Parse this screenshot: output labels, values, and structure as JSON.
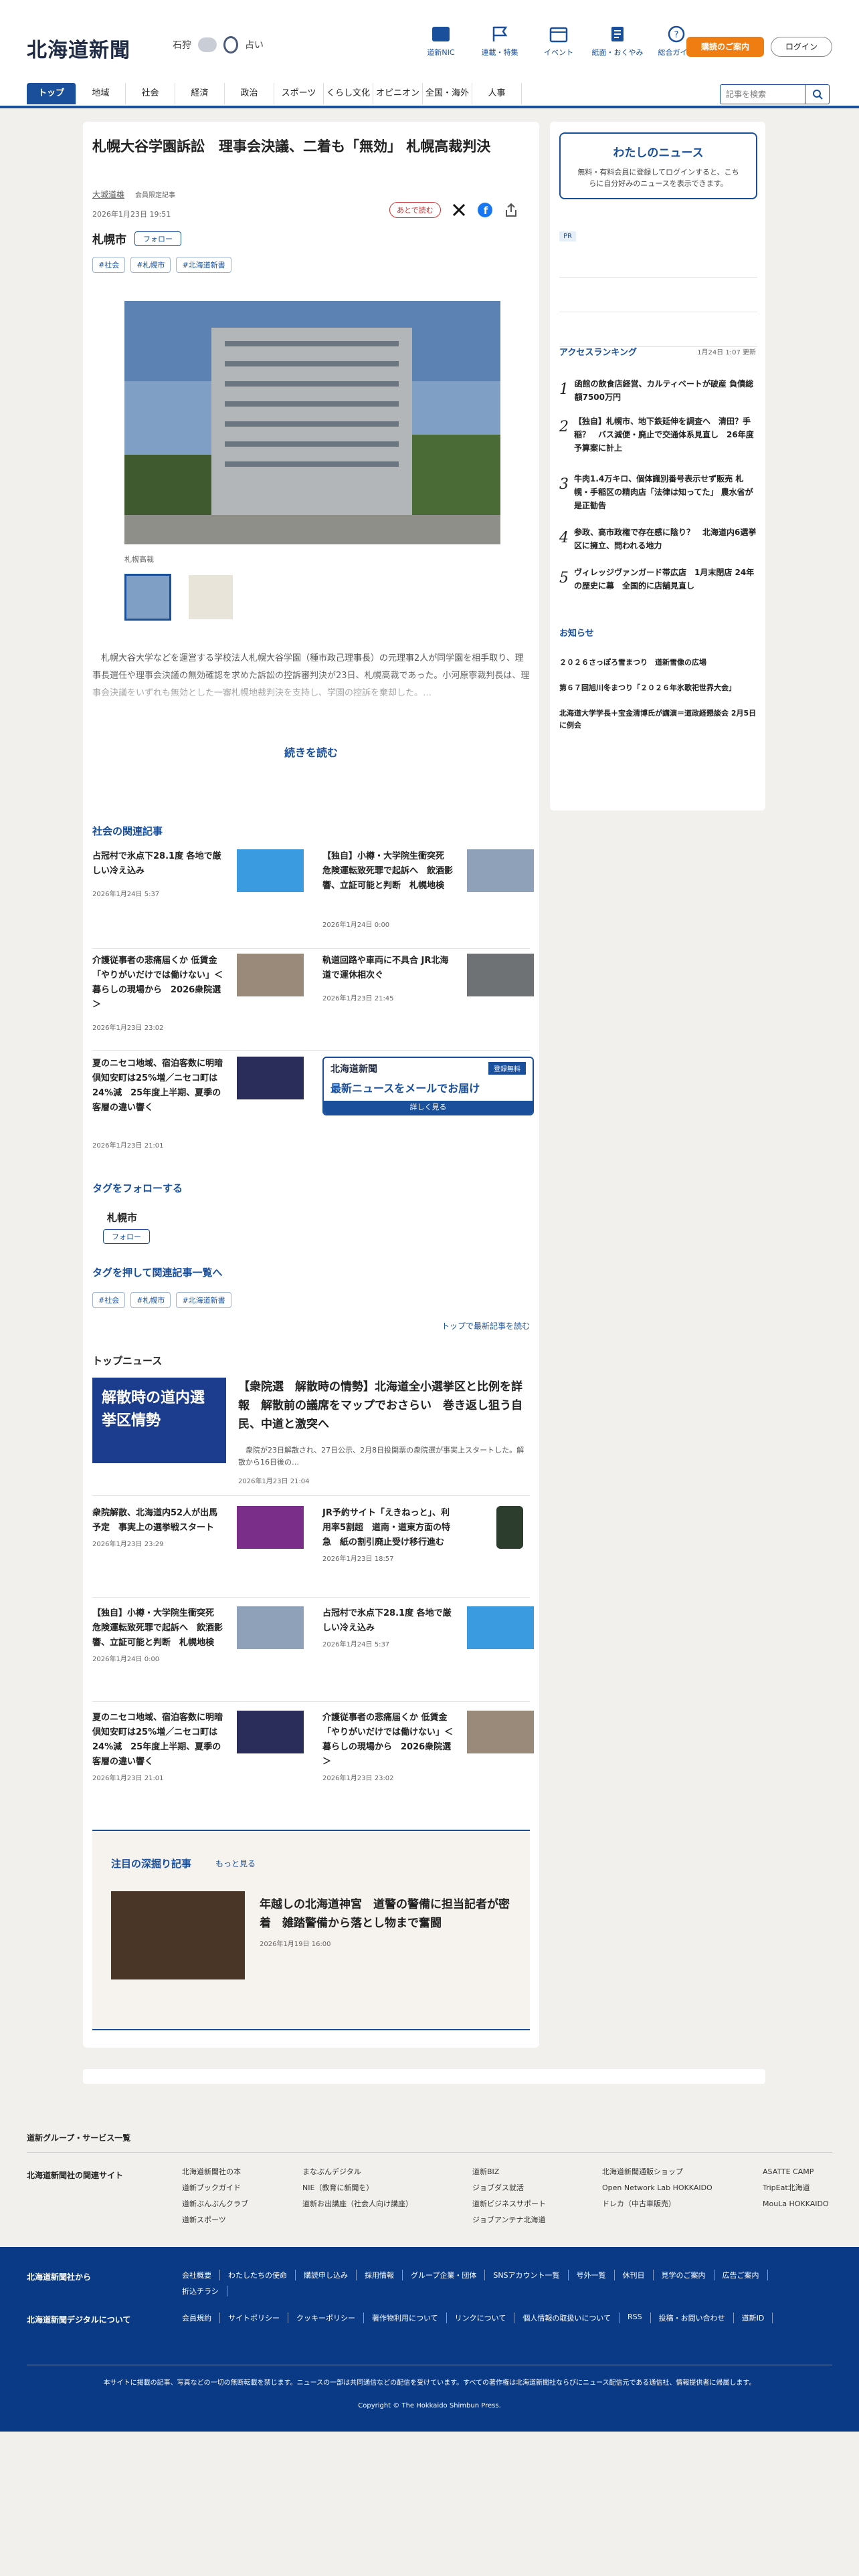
{
  "header": {
    "logo": "北海道新聞",
    "weather_city": "石狩",
    "weather_note": "占い",
    "icons": [
      {
        "label": "道新NIC",
        "icon": "note-icon"
      },
      {
        "label": "連載・特集",
        "icon": "flag-icon"
      },
      {
        "label": "イベント",
        "icon": "calendar-icon"
      },
      {
        "label": "紙面・おくやみ",
        "icon": "newspaper-icon"
      },
      {
        "label": "総合ガイド",
        "icon": "help-icon"
      }
    ],
    "member_button": "購読のご案内",
    "login_button": "ログイン"
  },
  "nav": {
    "items": [
      "トップ",
      "地域",
      "社会",
      "経済",
      "政治",
      "スポーツ",
      "くらし文化",
      "オピニオン",
      "全国・海外",
      "人事"
    ],
    "search_placeholder": "記事を検索"
  },
  "article": {
    "title": "札幌大谷学園訴訟　理事会決議、二着も「無効」 札幌高裁判決",
    "author": "大城道雄",
    "member_badge": "会員限定記事",
    "date": "2026年1月23日 19:51",
    "later_label": "あとで読む",
    "location": "札幌市",
    "follow_label": "フォロー",
    "tags": [
      "#社会",
      "#札幌市",
      "#北海道新書"
    ],
    "caption": "札幌高裁",
    "lead": "札幌大谷大学などを運営する学校法人札幌大谷学園（種市政己理事長）の元理事2人が同学園を相手取り、理事長選任や理事会決議の無効確認を求めた訴訟の控訴審判決が23日、札幌高裁であった。小河原寧裁判長は、理事会決議をいずれも無効とした一審札幌地裁判決を支持し、学園の控訴を棄却した。…",
    "read_more": "続きを読む"
  },
  "related": {
    "heading": "社会の関連記事",
    "items": [
      {
        "title": "占冠村で氷点下28.1度 各地で厳しい冷え込み",
        "date": "2026年1月24日 5:37"
      },
      {
        "title": "【独自】小樽・大学院生衝突死　危険運転致死罪で起訴へ　飲酒影響、立証可能と判断　札幌地検",
        "date": "2026年1月24日 0:00"
      },
      {
        "title": "介護従事者の悲痛届くか 低賃金「やりがいだけでは働けない」＜暮らしの現場から　2026衆院選＞",
        "date": "2026年1月23日 23:02"
      },
      {
        "title": "軌道回路や車両に不具合 JR北海道で運休相次ぐ",
        "date": "2026年1月23日 21:45"
      },
      {
        "title": "夏のニセコ地域、宿泊客数に明暗　倶知安町は25%増／ニセコ町は24%減　25年度上半期、夏季の客層の違い響く",
        "date": "2026年1月23日 21:01"
      }
    ],
    "ad_logo": "北海道新聞",
    "ad_badge": "登録無料",
    "ad_text": "最新ニュースをメールでお届け",
    "ad_button": "詳しく見る"
  },
  "follow_tags": {
    "heading": "タグをフォローする",
    "location": "札幌市",
    "follow_label": "フォロー",
    "heading2": "タグを押して関連記事一覧へ",
    "tags": [
      "#社会",
      "#札幌市",
      "#北海道新書"
    ],
    "to_top": "トップで最新記事を読む"
  },
  "top_news": {
    "heading": "トップニュース",
    "lead_title": "【衆院選　解散時の情勢】北海道全小選挙区と比例を詳報　解散前の議席をマップでおさらい　巻き返し狙う自民、中道と激突へ",
    "lead_body": "衆院が23日解散され、27日公示、2月8日投開票の衆院選が事実上スタートした。解散から16日後の…",
    "lead_date": "2026年1月23日 21:04",
    "lead_img_text": "解散時の道内選挙区情勢",
    "items": [
      {
        "title": "衆院解散、北海道内52人が出馬予定　事実上の選挙戦スタート",
        "date": "2026年1月23日 23:29"
      },
      {
        "title": "JR予約サイト「えきねっと」、利用率5割超　道南・道東方面の特急　紙の割引廃止受け移行進む",
        "date": "2026年1月23日 18:57"
      },
      {
        "title": "【独自】小樽・大学院生衝突死　危険運転致死罪で起訴へ　飲酒影響、立証可能と判断　札幌地検",
        "date": "2026年1月24日 0:00"
      },
      {
        "title": "占冠村で氷点下28.1度 各地で厳しい冷え込み",
        "date": "2026年1月24日 5:37"
      },
      {
        "title": "夏のニセコ地域、宿泊客数に明暗　倶知安町は25%増／ニセコ町は24%減　25年度上半期、夏季の客層の違い響く",
        "date": "2026年1月23日 21:01"
      },
      {
        "title": "介護従事者の悲痛届くか 低賃金「やりがいだけでは働けない」＜暮らしの現場から　2026衆院選＞",
        "date": "2026年1月23日 23:02"
      }
    ]
  },
  "deep": {
    "heading": "注目の深掘り記事",
    "more": "もっと見る",
    "title": "年越しの北海道神宮　道警の警備に担当記者が密着　雑踏警備から落とし物まで奮闘",
    "date": "2026年1月19日 16:00"
  },
  "sidebar": {
    "my_news_title": "わたしのニュース",
    "my_news_text": "無料・有料会員に登録してログインすると、こちらに自分好みのニュースを表示できます。",
    "pr": "PR",
    "ranking_title": "アクセスランキング",
    "ranking_updated": "1月24日 1:07 更新",
    "ranking": [
      "函館の飲食店経営、カルティベートが破産 負債総額7500万円",
      "【独自】札幌市、地下鉄延伸を調査へ　清田？手稲？　バス減便・廃止で交通体系見直し　26年度予算案に計上",
      "牛肉1.4万キロ、個体識別番号表示せず販売 札幌・手稲区の精肉店「法律は知ってた」 農水省が是正勧告",
      "参政、高市政権で存在感に陰り？　北海道内6選挙区に擁立、問われる地力",
      "ヴィレッジヴァンガード帯広店　1月末閉店 24年の歴史に幕　全国的に店舗見直し"
    ],
    "notice_title": "お知らせ",
    "notices": [
      "２０２６さっぽろ雪まつり　道新雪像の広場",
      "第６７回旭川冬まつり「２０２６年氷歌祀世界大会」",
      "北海道大学学長＋宝金清博氏が講演＝道政経懇談会 2月5日に例会"
    ]
  },
  "footer": {
    "group_label": "道新グループ・サービス一覧",
    "related_label": "北海道新聞社の関連サイト",
    "related_sites": [
      "北海道新聞社の本",
      "道新ブックガイド",
      "道新ぶんぶんクラブ",
      "道新スポーツ",
      "まなぶんデジタル",
      "NIE（教育に新聞を）",
      "道新お出講座（社会人向け講座）",
      "道新BIZ",
      "ジョブダス就活",
      "道新ビジネスサポート",
      "ジョブアンテナ北海道",
      "北海道新聞通販ショップ",
      "Open Network Lab HOKKAIDO",
      "ドレカ（中古車販売）",
      "ASATTE CAMP",
      "TripEat北海道",
      "MouLa HOKKAIDO"
    ],
    "company_label": "北海道新聞社から",
    "company_links": [
      "会社概要",
      "わたしたちの使命",
      "購読申し込み",
      "採用情報",
      "グループ企業・団体",
      "SNSアカウント一覧",
      "号外一覧",
      "休刊日",
      "見学のご案内",
      "広告ご案内",
      "折込チラシ"
    ],
    "digital_label": "北海道新聞デジタルについて",
    "digital_links": [
      "会員規約",
      "サイトポリシー",
      "クッキーポリシー",
      "著作物利用について",
      "リンクについて",
      "個人情報の取扱いについて",
      "RSS",
      "投稿・お問い合わせ",
      "道新ID"
    ],
    "notice": "本サイトに掲載の記事、写真などの一切の無断転載を禁じます。ニュースの一部は共同通信などの配信を受けています。すべての著作権は北海道新聞社ならびにニュース配信元である通信社、情報提供者に帰属します。",
    "copyright": "Copyright © The Hokkaido Shimbun Press."
  },
  "colors": {
    "brand": "#1a4f9c",
    "accent": "#ef7d11",
    "footer_bg": "#0a3a86"
  }
}
